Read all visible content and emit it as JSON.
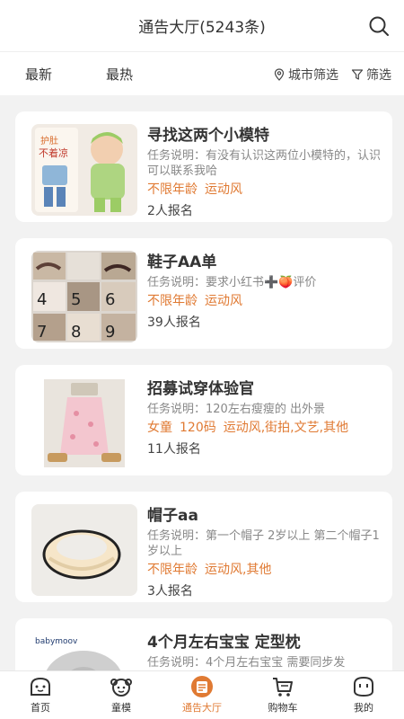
{
  "header": {
    "title": "通告大厅(5243条)"
  },
  "filters": {
    "latest": "最新",
    "hottest": "最热",
    "city": "城市筛选",
    "filter": "筛选"
  },
  "cards": [
    {
      "title": "寻找这两个小模特",
      "desc": "任务说明：有没有认识这两位小模特的，认识可以联系我哈",
      "tags": [
        "不限年龄",
        "运动风"
      ],
      "count": "2人报名",
      "thumb_text": [
        "护肚",
        "不着凉"
      ]
    },
    {
      "title": "鞋子AA单",
      "desc": "任务说明：要求小红书➕🍑评价",
      "tags": [
        "不限年龄",
        "运动风"
      ],
      "count": "39人报名",
      "thumb_text": [
        "4",
        "5",
        "6",
        "7",
        "8",
        "9"
      ]
    },
    {
      "title": "招募试穿体验官",
      "desc": "任务说明：120左右瘦瘦的 出外景",
      "tags": [
        "女童",
        "120码",
        "运动风,街拍,文艺,其他"
      ],
      "count": "11人报名"
    },
    {
      "title": "帽子aa",
      "desc": "任务说明：第一个帽子 2岁以上 第二个帽子1岁以上",
      "tags": [
        "不限年龄",
        "运动风,其他"
      ],
      "count": "3人报名"
    },
    {
      "title": "4个月左右宝宝 定型枕",
      "desc": "任务说明：4个月左右宝宝 需要同步发",
      "tags": [],
      "count": "",
      "thumb_text": [
        "babymoov"
      ]
    }
  ],
  "tabbar": [
    {
      "label": "首页",
      "icon": "home-icon"
    },
    {
      "label": "童模",
      "icon": "child-model-icon"
    },
    {
      "label": "通告大厅",
      "icon": "notice-hall-icon",
      "active": true
    },
    {
      "label": "购物车",
      "icon": "cart-icon"
    },
    {
      "label": "我的",
      "icon": "profile-icon"
    }
  ],
  "colors": {
    "accent": "#e07a33",
    "tag": "#e07a33"
  }
}
